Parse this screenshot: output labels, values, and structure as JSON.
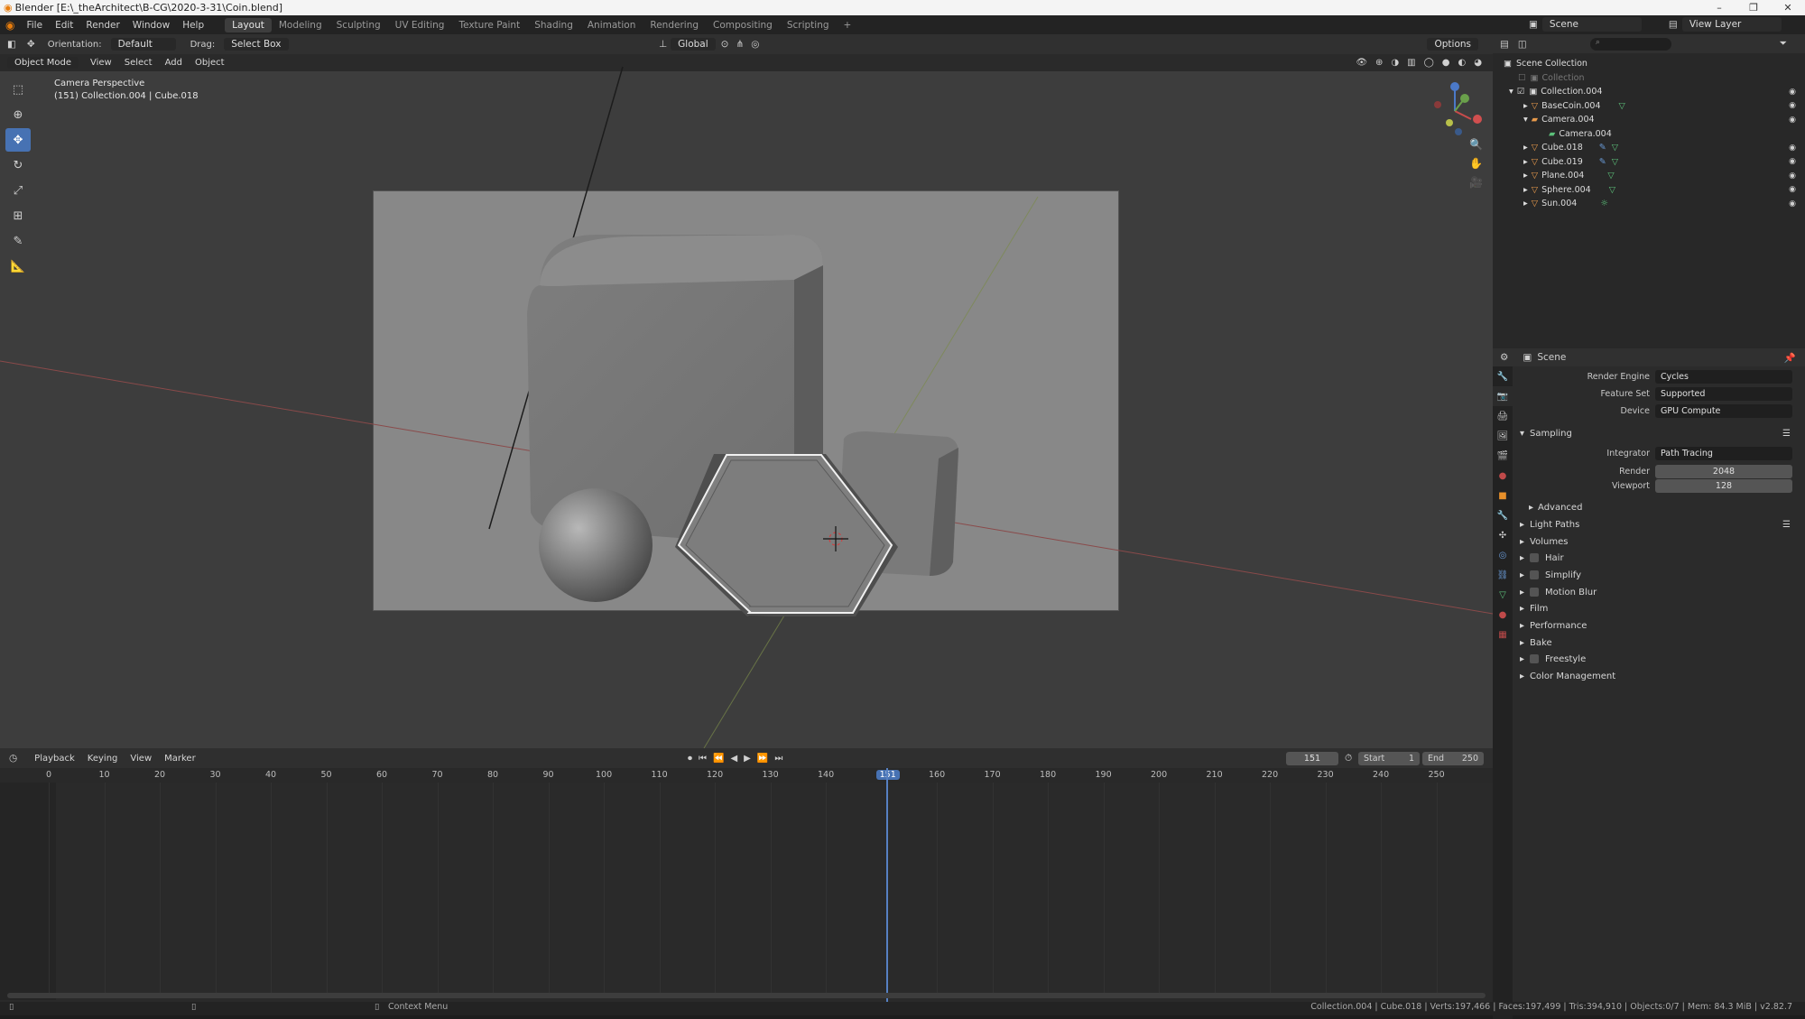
{
  "window": {
    "title": "Blender [E:\\_theArchitect\\B-CG\\2020-3-31\\Coin.blend]",
    "minimize": "–",
    "maximize": "❐",
    "close": "✕"
  },
  "menu": [
    "File",
    "Edit",
    "Render",
    "Window",
    "Help"
  ],
  "workspaces": [
    "Layout",
    "Modeling",
    "Sculpting",
    "UV Editing",
    "Texture Paint",
    "Shading",
    "Animation",
    "Rendering",
    "Compositing",
    "Scripting"
  ],
  "active_workspace": "Layout",
  "scene_name": "Scene",
  "view_layer": "View Layer",
  "tool_header": {
    "orientation_label": "Orientation:",
    "orientation_value": "Default",
    "drag_label": "Drag:",
    "drag_value": "Select Box",
    "transform_orientation": "Global",
    "options": "Options"
  },
  "viewport_header": {
    "mode": "Object Mode",
    "menus": [
      "View",
      "Select",
      "Add",
      "Object"
    ]
  },
  "viewport": {
    "overlay_line1": "Camera Perspective",
    "overlay_line2": "(151) Collection.004 | Cube.018"
  },
  "outliner": {
    "root": "Scene Collection",
    "items": [
      {
        "label": "Collection"
      },
      {
        "label": "Collection.004"
      },
      {
        "label": "BaseCoin.004"
      },
      {
        "label": "Camera.004"
      },
      {
        "label": "Camera.004"
      },
      {
        "label": "Cube.018"
      },
      {
        "label": "Cube.019"
      },
      {
        "label": "Plane.004"
      },
      {
        "label": "Sphere.004"
      },
      {
        "label": "Sun.004"
      }
    ]
  },
  "properties": {
    "context": "Scene",
    "render_engine_label": "Render Engine",
    "render_engine": "Cycles",
    "feature_set_label": "Feature Set",
    "feature_set": "Supported",
    "device_label": "Device",
    "device": "GPU Compute",
    "sampling_label": "Sampling",
    "integrator_label": "Integrator",
    "integrator": "Path Tracing",
    "render_label": "Render",
    "render_samples": "2048",
    "viewport_label": "Viewport",
    "viewport_samples": "128",
    "advanced_label": "Advanced",
    "panels": [
      {
        "label": "Light Paths"
      },
      {
        "label": "Volumes"
      },
      {
        "label": "Hair"
      },
      {
        "label": "Simplify"
      },
      {
        "label": "Motion Blur"
      },
      {
        "label": "Film"
      },
      {
        "label": "Performance"
      },
      {
        "label": "Bake"
      },
      {
        "label": "Freestyle"
      },
      {
        "label": "Color Management"
      }
    ]
  },
  "timeline": {
    "menus": [
      "Playback",
      "Keying",
      "View",
      "Marker"
    ],
    "current_frame": "151",
    "start_label": "Start",
    "start": "1",
    "end_label": "End",
    "end": "250",
    "ticks": [
      "0",
      "10",
      "20",
      "30",
      "40",
      "50",
      "60",
      "70",
      "80",
      "90",
      "100",
      "110",
      "120",
      "130",
      "140",
      "151",
      "160",
      "170",
      "180",
      "190",
      "200",
      "210",
      "220",
      "230",
      "240",
      "250"
    ]
  },
  "status": {
    "context_menu": "Context Menu",
    "stats": "Collection.004 | Cube.018 | Verts:197,466 | Faces:197,499 | Tris:394,910 | Objects:0/7 | Mem: 84.3 MiB | v2.82.7"
  }
}
